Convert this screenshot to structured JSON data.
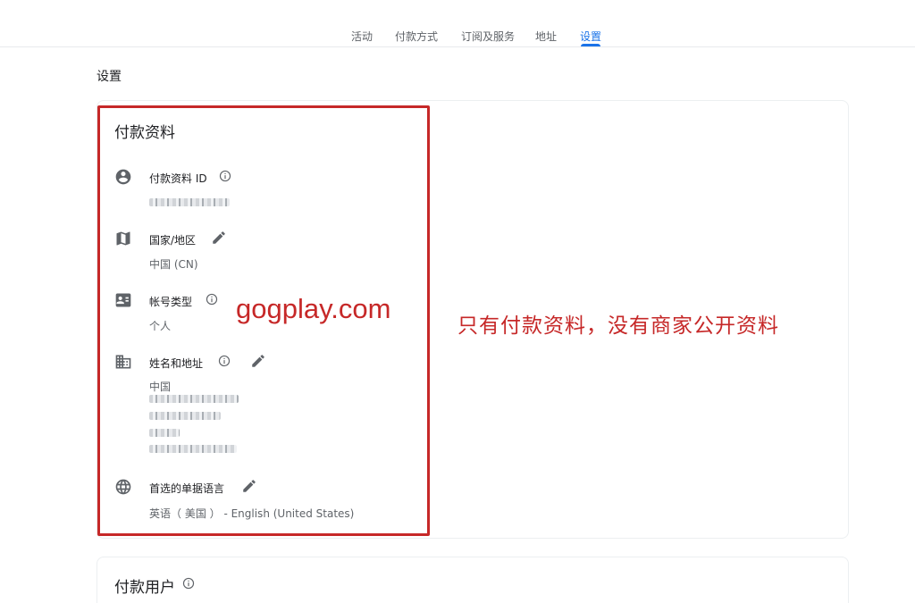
{
  "nav": {
    "tabs": [
      {
        "label": "活动"
      },
      {
        "label": "付款方式"
      },
      {
        "label": "订阅及服务"
      },
      {
        "label": "地址"
      },
      {
        "label": "设置",
        "active": true
      }
    ],
    "accent_color": "#1a73e8"
  },
  "page_title": "设置",
  "payment_profile": {
    "title": "付款资料",
    "rows": [
      {
        "icon": "account-circle-icon",
        "label": "付款资料 ID",
        "value": "(blurred)"
      },
      {
        "icon": "map-icon",
        "label": "国家/地区",
        "value": "中国 (CN)"
      },
      {
        "icon": "id-card-icon",
        "label": "帐号类型",
        "value": "个人"
      },
      {
        "icon": "building-icon",
        "label": "姓名和地址",
        "value": "中国"
      },
      {
        "icon": "globe-icon",
        "label": "首选的单据语言",
        "value": "英语（ 美国 ） - English (United States)"
      }
    ]
  },
  "overlay": {
    "watermark": "gogplay.com",
    "annotation": "只有付款资料，没有商家公开资料",
    "color": "#c62828"
  },
  "payment_users": {
    "title": "付款用户"
  }
}
